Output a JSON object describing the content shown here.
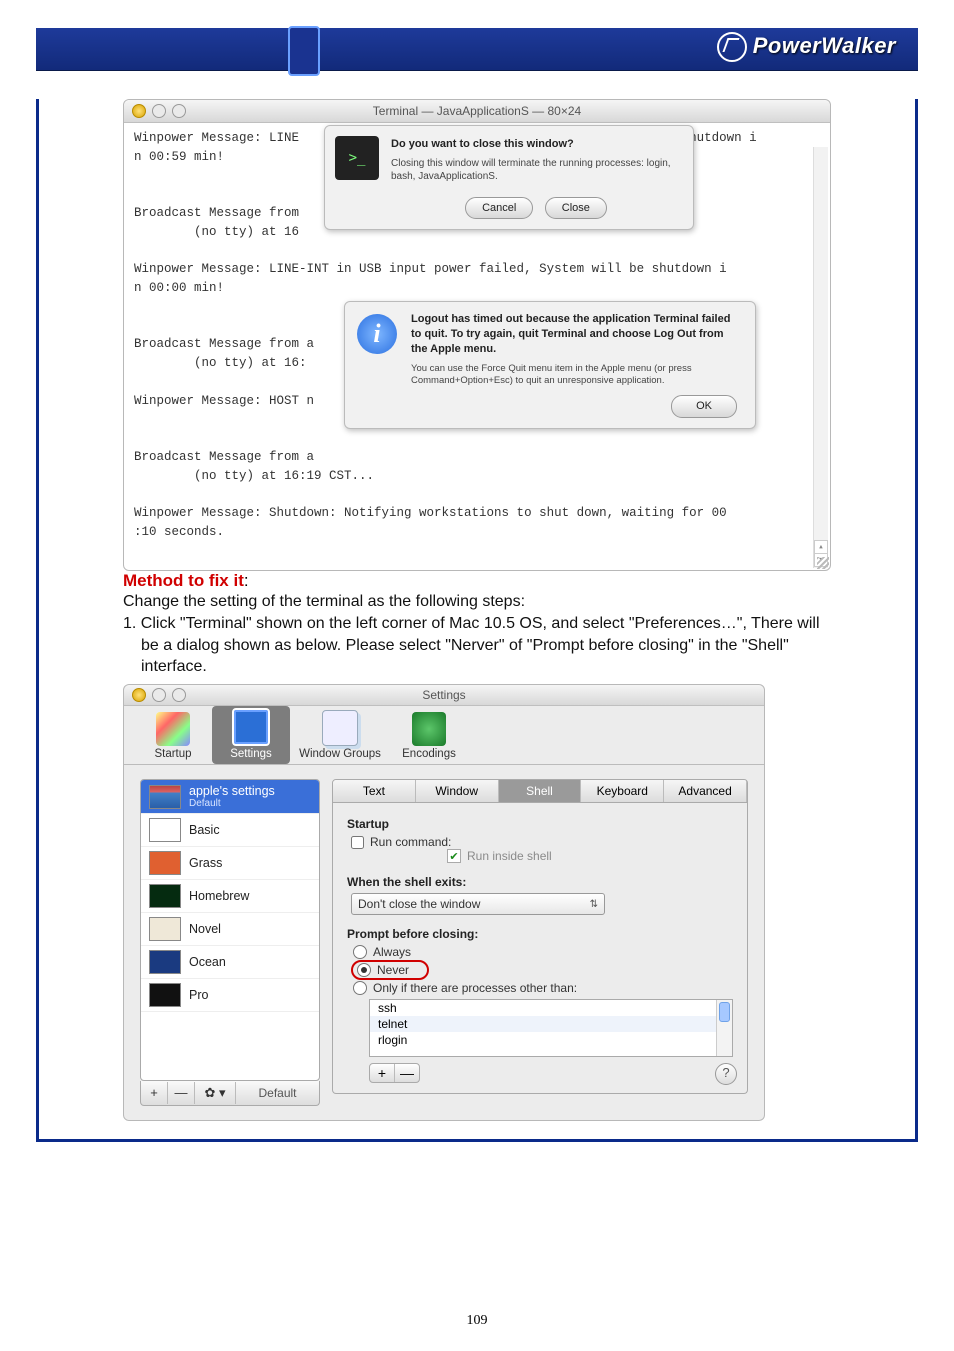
{
  "brand": "PowerWalker",
  "terminal": {
    "title": "Terminal — JavaApplicationS — 80×24",
    "lines": [
      "Winpower Message: LINE                                           will be shutdown i",
      "n 00:59 min!",
      "",
      "",
      "Broadcast Message from              ",
      "        (no tty) at 16",
      "",
      "Winpower Message: LINE-INT in USB input power failed, System will be shutdown i",
      "n 00:00 min!",
      "",
      "",
      "Broadcast Message from a",
      "        (no tty) at 16:",
      "",
      "Winpower Message: HOST n",
      "",
      "",
      "Broadcast Message from a",
      "        (no tty) at 16:19 CST...",
      "",
      "Winpower Message: Shutdown: Notifying workstations to shut down, waiting for 00",
      ":10 seconds.",
      ""
    ]
  },
  "closeDialog": {
    "title": "Do you want to close this window?",
    "body": "Closing this window will terminate the running processes: login, bash, JavaApplicationS.",
    "cancel": "Cancel",
    "close": "Close"
  },
  "logoutDialog": {
    "title": "Logout has timed out because the application Terminal failed to quit. To try again, quit Terminal and choose Log Out from the Apple menu.",
    "body": "You can use the Force Quit menu item in the Apple menu (or press Command+Option+Esc) to quit an unresponsive application.",
    "ok": "OK"
  },
  "fix": {
    "head": "Method to fix it",
    "intro": "Change the setting of the terminal as the following steps:",
    "step1": "1.  Click \"Terminal\" shown on the left corner of Mac 10.5 OS, and select \"Preferences…\", There will be a dialog shown as below. Please select \"Nerver\" of \"Prompt before closing\" in the \"Shell\" interface."
  },
  "settings": {
    "title": "Settings",
    "toolbar": {
      "startup": "Startup",
      "settings": "Settings",
      "windowGroups": "Window Groups",
      "encodings": "Encodings"
    },
    "profiles": [
      {
        "name": "apple's settings",
        "sub": "Default",
        "thumb": "th-apple",
        "sel": true
      },
      {
        "name": "Basic",
        "thumb": "th-basic"
      },
      {
        "name": "Grass",
        "thumb": "th-grass"
      },
      {
        "name": "Homebrew",
        "thumb": "th-homebrew"
      },
      {
        "name": "Novel",
        "thumb": "th-novel"
      },
      {
        "name": "Ocean",
        "thumb": "th-ocean"
      },
      {
        "name": "Pro",
        "thumb": "th-pro"
      }
    ],
    "profileBar": {
      "plus": "+",
      "minus": "—",
      "gear": "✿ ▾",
      "label": "Default"
    },
    "tabs": {
      "text": "Text",
      "window": "Window",
      "shell": "Shell",
      "keyboard": "Keyboard",
      "advanced": "Advanced"
    },
    "shell": {
      "startup": "Startup",
      "runCmd": "Run command:",
      "runInside": "Run inside shell",
      "whenExits": "When the shell exits:",
      "exitSelect": "Don't close the window",
      "promptHead": "Prompt before closing:",
      "optAlways": "Always",
      "optNever": "Never",
      "optOnly": "Only if there are processes other than:",
      "procs": [
        "rlogin",
        "telnet",
        "ssh"
      ],
      "plus": "+",
      "minus": "—"
    }
  },
  "pageNumber": "109"
}
